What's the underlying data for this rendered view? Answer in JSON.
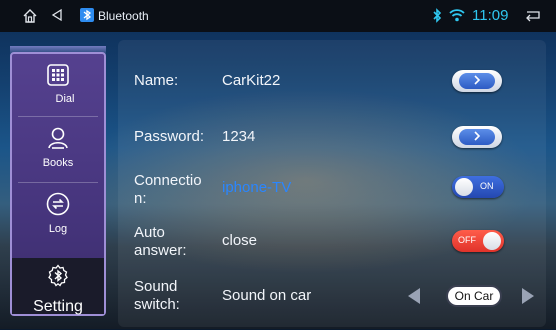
{
  "status_bar": {
    "title": "Bluetooth",
    "time": "11:09",
    "icons": [
      "home-icon",
      "back-triangle-icon",
      "bluetooth-app-icon",
      "bluetooth-icon",
      "wifi-icon",
      "return-icon"
    ]
  },
  "sidebar": {
    "items": [
      {
        "label": "Dial",
        "icon": "dialpad-icon"
      },
      {
        "label": "Books",
        "icon": "contacts-icon"
      },
      {
        "label": "Log",
        "icon": "call-log-icon"
      },
      {
        "label": "Setting",
        "icon": "bluetooth-settings-icon"
      }
    ],
    "selected": "Setting"
  },
  "settings": {
    "name": {
      "label": "Name:",
      "value": "CarKit22"
    },
    "password": {
      "label": "Password:",
      "value": "1234"
    },
    "connection": {
      "label_line1": "Connectio",
      "label_line2": "n:",
      "value": "iphone-TV",
      "toggle": "ON"
    },
    "auto_answer": {
      "label_line1": "Auto",
      "label_line2": "answer:",
      "value": "close",
      "toggle": "OFF"
    },
    "sound_switch": {
      "label_line1": "Sound",
      "label_line2": "switch:",
      "value": "Sound on car",
      "option": "On Car"
    }
  },
  "colors": {
    "accent_time": "#2fc7f0",
    "connection_value": "#2a86ff",
    "toggle_on": "#2f5bd0",
    "toggle_off": "#e8392d",
    "sidebar": "#4a3a85"
  }
}
